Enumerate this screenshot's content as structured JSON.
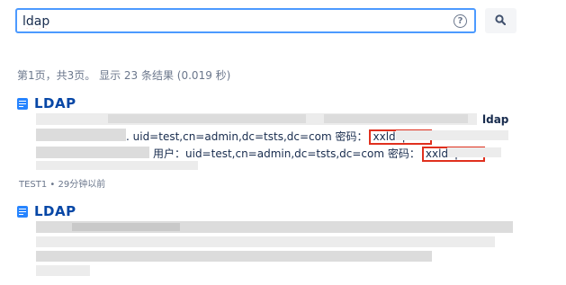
{
  "search": {
    "value": "ldap",
    "help_icon": "?"
  },
  "summary": "第1页，共3页。 显示 23 条结果 (0.019 秒)",
  "results": [
    {
      "title": "LDAP",
      "tail_fragment": "ldap",
      "line1_text": ". uid=test,cn=admin,dc=tsts,dc=com 密码：",
      "line1_highlight": "xxldap!&S",
      "line2_text": "用户：uid=test,cn=admin,dc=tsts,dc=com 密码：",
      "line2_highlight": "xxldap!&S",
      "meta": "TEST1 • 29分钟以前"
    },
    {
      "title": "LDAP"
    }
  ]
}
